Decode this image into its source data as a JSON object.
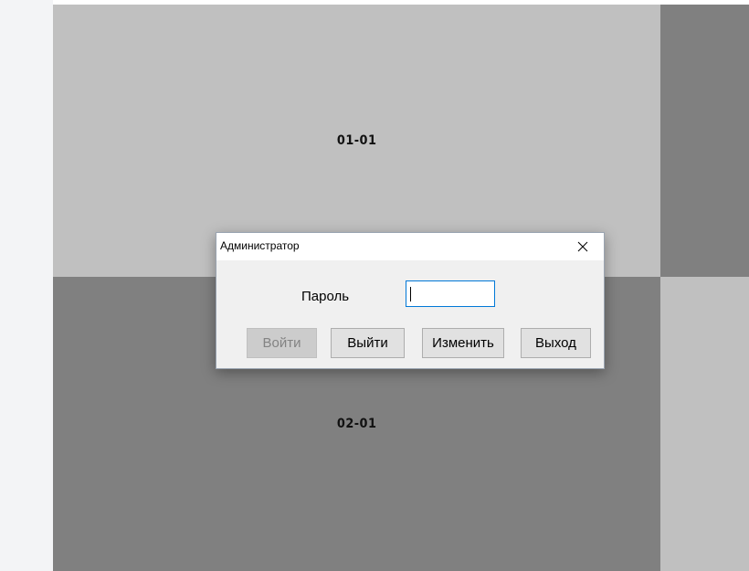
{
  "grid": {
    "cells": [
      {
        "label": "01-01"
      },
      {
        "label": "02-01"
      }
    ]
  },
  "dialog": {
    "title": "Администратор",
    "close_icon": "close-icon",
    "password_label": "Пароль",
    "password_value": "",
    "buttons": {
      "login": "Войти",
      "logout": "Выйти",
      "change": "Изменить",
      "exit": "Выход"
    },
    "login_enabled": false
  },
  "colors": {
    "cell_light": "#c0c0c0",
    "cell_dark": "#808080",
    "focus_accent": "#0078d7"
  }
}
